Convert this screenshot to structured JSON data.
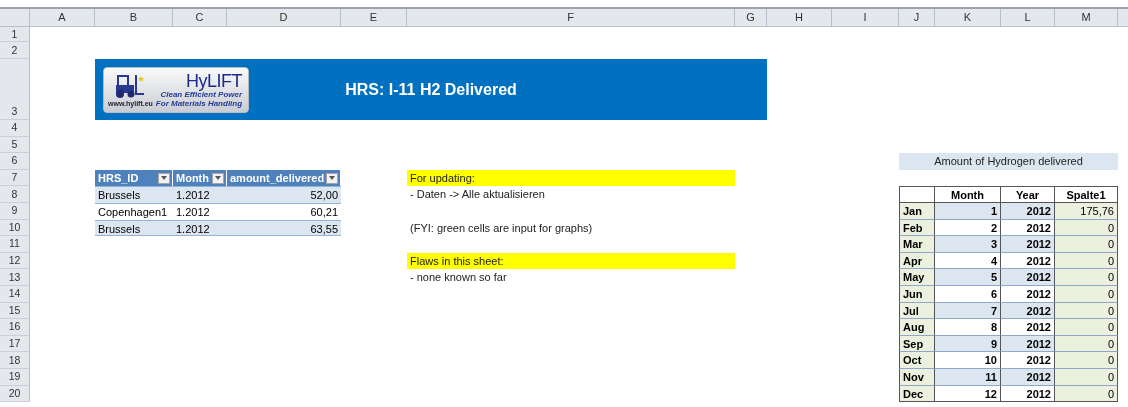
{
  "column_headers": [
    "A",
    "B",
    "C",
    "D",
    "E",
    "F",
    "G",
    "H",
    "I",
    "J",
    "K",
    "L",
    "M"
  ],
  "row_headers": [
    "1",
    "2",
    "3",
    "4",
    "5",
    "6",
    "7",
    "8",
    "9",
    "10",
    "11",
    "12",
    "13",
    "14",
    "15",
    "16",
    "17",
    "18",
    "19",
    "20"
  ],
  "banner": {
    "title": "HRS: I-11 H2 Delivered",
    "logo": {
      "name": "HyLIFT",
      "tagline": [
        "Clean Efficient Power",
        "For Materials Handling"
      ],
      "url": "www.hylift.eu"
    }
  },
  "delivery_table": {
    "columns": [
      "HRS_ID",
      "Month",
      "amount_delivered"
    ],
    "rows": [
      [
        "Brussels",
        "1.2012",
        "52,00"
      ],
      [
        "Copenhagen1",
        "1.2012",
        "60,21"
      ],
      [
        "Brussels",
        "1.2012",
        "63,55"
      ]
    ]
  },
  "notes": [
    {
      "kind": "heading",
      "text": "For updating:"
    },
    {
      "kind": "step",
      "text": "- Daten -> Alle aktualisieren"
    },
    {
      "kind": "remark",
      "text": "(FYI: green cells are input for graphs)"
    },
    {
      "kind": "heading",
      "text": "Flaws in this sheet:"
    },
    {
      "kind": "step",
      "text": "- none known so far"
    }
  ],
  "summary": {
    "title": "Amount of Hydrogen delivered",
    "columns": [
      "Month",
      "Year",
      "Spalte1"
    ],
    "rows": [
      [
        "Jan",
        "1",
        "2012",
        "175,76"
      ],
      [
        "Feb",
        "2",
        "2012",
        "0"
      ],
      [
        "Mar",
        "3",
        "2012",
        "0"
      ],
      [
        "Apr",
        "4",
        "2012",
        "0"
      ],
      [
        "May",
        "5",
        "2012",
        "0"
      ],
      [
        "Jun",
        "6",
        "2012",
        "0"
      ],
      [
        "Jul",
        "7",
        "2012",
        "0"
      ],
      [
        "Aug",
        "8",
        "2012",
        "0"
      ],
      [
        "Sep",
        "9",
        "2012",
        "0"
      ],
      [
        "Oct",
        "10",
        "2012",
        "0"
      ],
      [
        "Nov",
        "11",
        "2012",
        "0"
      ],
      [
        "Dec",
        "12",
        "2012",
        "0"
      ]
    ]
  }
}
